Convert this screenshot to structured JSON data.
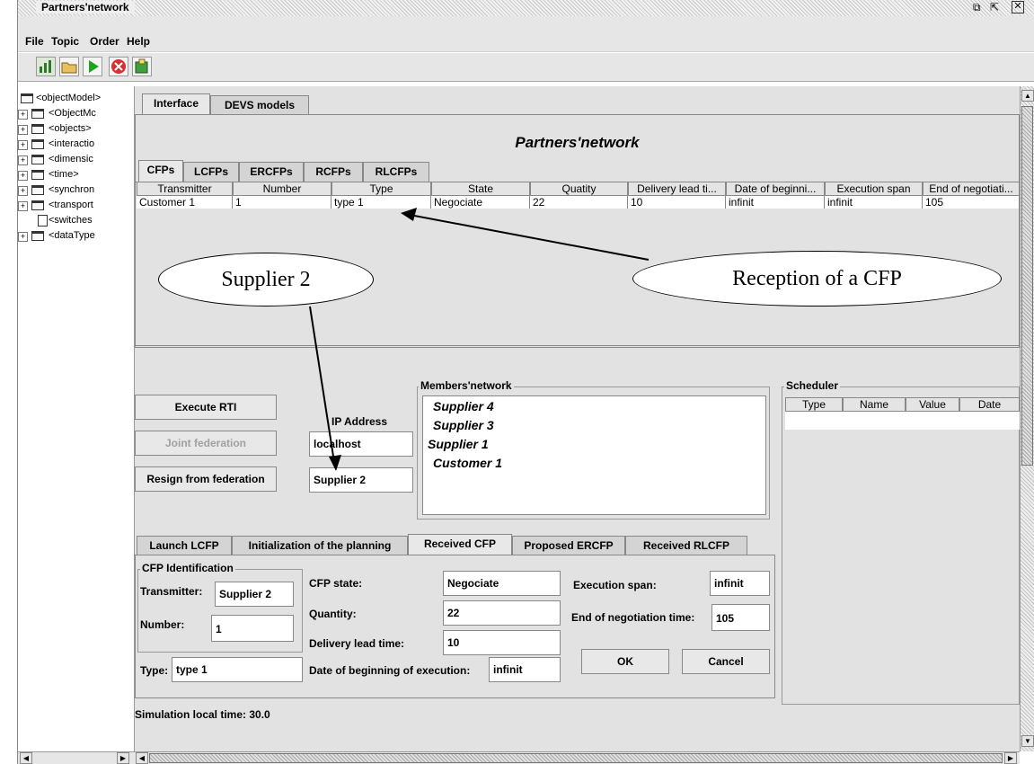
{
  "window": {
    "title": "Partners'network"
  },
  "menu": {
    "items": [
      "File",
      "Topic",
      "Order",
      "Help"
    ]
  },
  "tree": {
    "items": [
      "<objectModel>",
      "<ObjectMc",
      "<objects>",
      "<interactio",
      "<dimensic",
      "<time>",
      "<synchron",
      "<transport",
      "<switches",
      "<dataType"
    ]
  },
  "main": {
    "tabs": [
      "Interface",
      "DEVS models"
    ],
    "network_title": "Partners'network",
    "cfp_tabs": [
      "CFPs",
      "LCFPs",
      "ERCFPs",
      "RCFPs",
      "RLCFPs"
    ],
    "table": {
      "headers": [
        "Transmitter",
        "Number",
        "Type",
        "State",
        "Quatity",
        "Delivery lead ti...",
        "Date of beginni...",
        "Execution span",
        "End of negotiati..."
      ],
      "rows": [
        [
          "Customer 1",
          "1",
          "type 1",
          "Negociate",
          "22",
          "10",
          "infinit",
          "infinit",
          "105"
        ]
      ]
    }
  },
  "annotations": {
    "supplier_callout": "Supplier 2",
    "reception_callout": "Reception of a CFP"
  },
  "controls": {
    "execute_rti": "Execute RTI",
    "joint_federation": "Joint federation",
    "resign_federation": "Resign from federation",
    "ip_label": "IP Address",
    "ip_value": "localhost",
    "federate_name": "Supplier 2"
  },
  "members": {
    "title": "Members'network",
    "items": [
      "Supplier 4",
      "Supplier 3",
      "Supplier 1",
      "Customer 1"
    ]
  },
  "scheduler": {
    "title": "Scheduler",
    "headers": [
      "Type",
      "Name",
      "Value",
      "Date"
    ]
  },
  "bottom_tabs": [
    "Launch LCFP",
    "Initialization of the planning",
    "Received CFP",
    "Proposed ERCFP",
    "Received RLCFP"
  ],
  "received_cfp": {
    "group_title": "CFP Identification",
    "transmitter_label": "Transmitter:",
    "transmitter_value": "Supplier 2",
    "number_label": "Number:",
    "number_value": "1",
    "type_label": "Type:",
    "type_value": "type 1",
    "state_label": "CFP state:",
    "state_value": "Negociate",
    "quantity_label": "Quantity:",
    "quantity_value": "22",
    "lead_label": "Delivery lead time:",
    "lead_value": "10",
    "begin_label": "Date of beginning of execution:",
    "begin_value": "infinit",
    "span_label": "Execution span:",
    "span_value": "infinit",
    "end_label": "End of negotiation time:",
    "end_value": "105",
    "ok": "OK",
    "cancel": "Cancel"
  },
  "status": {
    "label": "Simulation local time:",
    "value": "30.0"
  }
}
